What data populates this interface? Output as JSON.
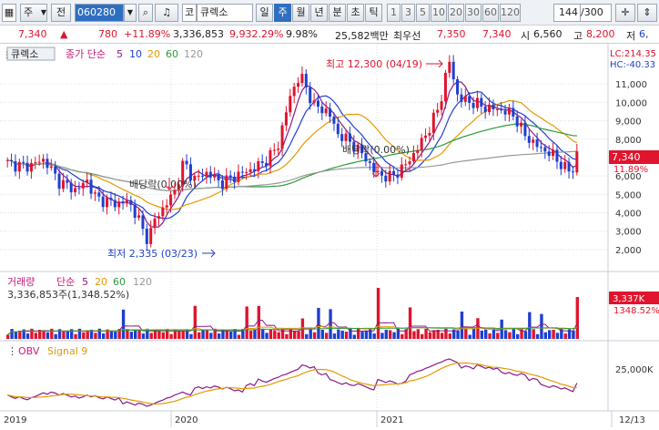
{
  "toolbar": {
    "mode": "주",
    "prev_label": "전",
    "code": "060280",
    "kind": "코",
    "name": "큐렉소",
    "periods": [
      "일",
      "주",
      "월",
      "년",
      "분",
      "초",
      "틱"
    ],
    "active_period": "주",
    "minutes": [
      "1",
      "3",
      "5",
      "10",
      "20",
      "30",
      "60",
      "120"
    ],
    "count": "144",
    "total": "/300"
  },
  "info": {
    "price": "7,340",
    "change": "780",
    "change_pct": "+11.89%",
    "volume": "3,336,853",
    "volume_pct": "9,932.29%",
    "turnover": "9.98%",
    "amount": "25,582백만",
    "best_ask_label": "최우선",
    "ask": "7,350",
    "bid": "7,340",
    "open_label": "시",
    "open": "6,560",
    "high_label": "고",
    "high": "8,200",
    "low_label": "저",
    "low": "6,"
  },
  "price_panel": {
    "title": "큐렉소",
    "legend_prefix": "종가 단순",
    "ma": [
      {
        "label": "5",
        "color": "#8a1a8a"
      },
      {
        "label": "10",
        "color": "#1f3fcf"
      },
      {
        "label": "20",
        "color": "#e39a00"
      },
      {
        "label": "60",
        "color": "#2e9a3a"
      },
      {
        "label": "120",
        "color": "#999999"
      }
    ],
    "lc": "LC:214.35",
    "hc": "HC:-40.33",
    "max_label": "최고 12,300 (04/19)",
    "min_label": "최저 2,335 (03/23)",
    "ex_dividend": "배당락(0.00%)",
    "ex_dividend_2": "배당락(0.00%)",
    "price_tag": "7,340",
    "pct_tag": "11.89%",
    "ticks": [
      "11,000",
      "10,000",
      "9,000",
      "8,000",
      "6,000",
      "5,000",
      "4,000",
      "3,000",
      "2,000"
    ]
  },
  "volume_panel": {
    "title": "거래량",
    "legend_prefix": "단순",
    "ma": [
      "5",
      "20",
      "60",
      "120"
    ],
    "value": "3,336,853주(1,348.52%)",
    "tag": "3,337K",
    "tag_pct": "1348.52%"
  },
  "obv_panel": {
    "title": "OBV",
    "signal": "Signal 9",
    "tick": "25,000K"
  },
  "xaxis": [
    "2019",
    "2020",
    "2021",
    "12/13"
  ]
}
